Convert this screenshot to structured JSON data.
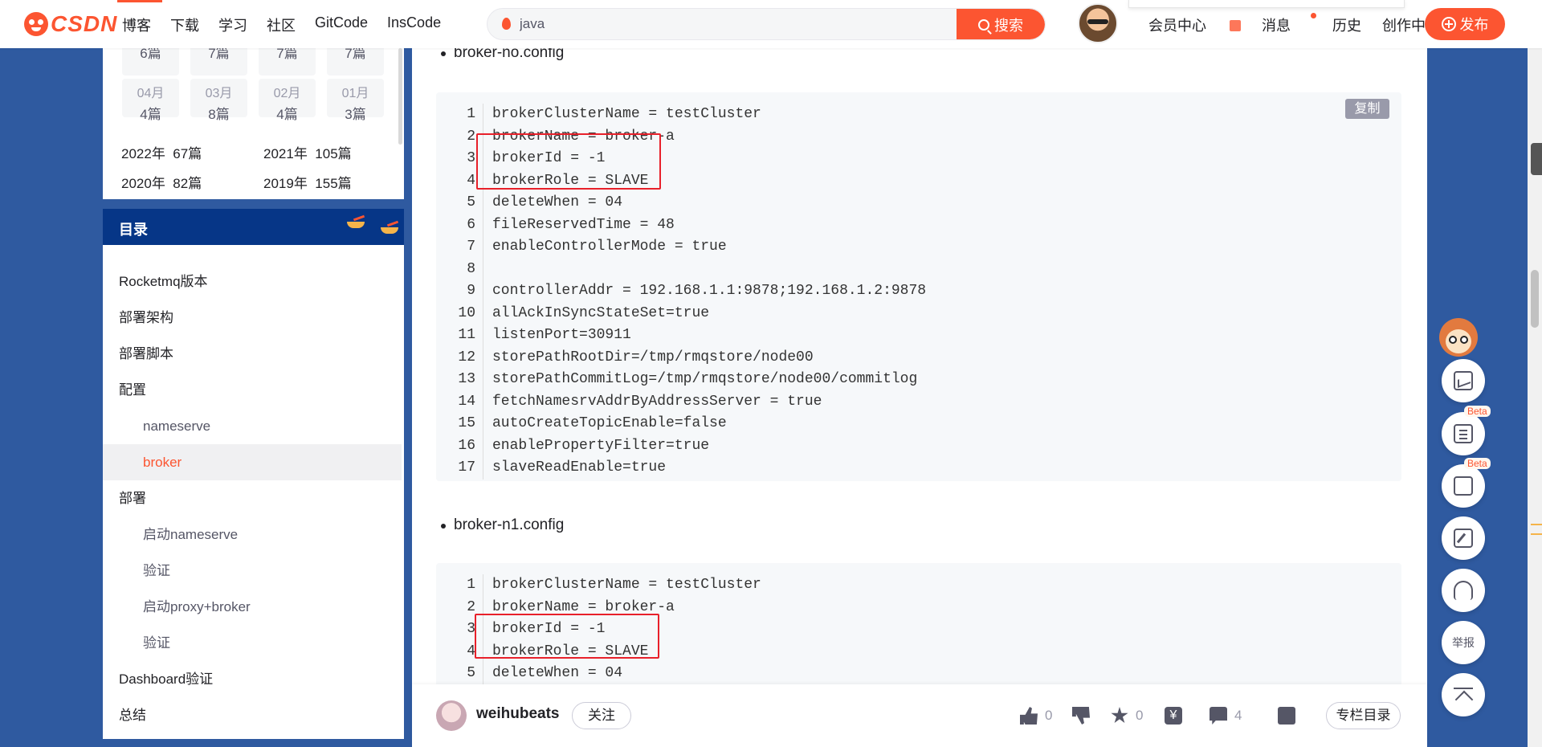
{
  "header": {
    "logo_text": "CSDN",
    "nav": [
      "博客",
      "下载",
      "学习",
      "社区",
      "GitCode",
      "InsCode"
    ],
    "search_value": "java",
    "search_button": "搜索",
    "right_nav": [
      "会员中心",
      "消息",
      "历史",
      "创作中心"
    ],
    "publish_label": "发布"
  },
  "archive": {
    "row1": [
      {
        "count": "6篇"
      },
      {
        "count": "7篇"
      },
      {
        "count": "7篇"
      },
      {
        "count": "7篇"
      }
    ],
    "row2": [
      {
        "month": "04月",
        "count": "4篇"
      },
      {
        "month": "03月",
        "count": "8篇"
      },
      {
        "month": "02月",
        "count": "4篇"
      },
      {
        "month": "01月",
        "count": "3篇"
      }
    ],
    "years": [
      {
        "year": "2022年",
        "count": "67篇"
      },
      {
        "year": "2021年",
        "count": "105篇"
      },
      {
        "year": "2020年",
        "count": "82篇"
      },
      {
        "year": "2019年",
        "count": "155篇"
      }
    ]
  },
  "toc": {
    "title": "目录",
    "items": [
      {
        "label": "Rocketmq版本",
        "level": 1
      },
      {
        "label": "部署架构",
        "level": 1
      },
      {
        "label": "部署脚本",
        "level": 1
      },
      {
        "label": "配置",
        "level": 1
      },
      {
        "label": "nameserve",
        "level": 2
      },
      {
        "label": "broker",
        "level": 2,
        "active": true
      },
      {
        "label": "部署",
        "level": 1
      },
      {
        "label": "启动nameserve",
        "level": 2
      },
      {
        "label": "验证",
        "level": 2
      },
      {
        "label": "启动proxy+broker",
        "level": 2
      },
      {
        "label": "验证",
        "level": 2
      },
      {
        "label": "Dashboard验证",
        "level": 1
      },
      {
        "label": "总结",
        "level": 1
      }
    ]
  },
  "article": {
    "bullet1": "broker-no.config",
    "bullet2": "broker-n1.config",
    "copy_label": "复制",
    "code1": {
      "line_numbers": [
        "1",
        "2",
        "3",
        "4",
        "5",
        "6",
        "7",
        "8",
        "9",
        "10",
        "11",
        "12",
        "13",
        "14",
        "15",
        "16",
        "17"
      ],
      "lines": [
        "brokerClusterName = testCluster",
        "brokerName = broker-a",
        "brokerId = -1",
        "brokerRole = SLAVE",
        "deleteWhen = 04",
        "fileReservedTime = 48",
        "enableControllerMode = true",
        "",
        "controllerAddr = 192.168.1.1:9878;192.168.1.2:9878",
        "allAckInSyncStateSet=true",
        "listenPort=30911",
        "storePathRootDir=/tmp/rmqstore/node00",
        "storePathCommitLog=/tmp/rmqstore/node00/commitlog",
        "fetchNamesrvAddrByAddressServer = true",
        "autoCreateTopicEnable=false",
        "enablePropertyFilter=true",
        "slaveReadEnable=true"
      ]
    },
    "code2": {
      "line_numbers": [
        "1",
        "2",
        "3",
        "4",
        "5"
      ],
      "lines": [
        "brokerClusterName = testCluster",
        "brokerName = broker-a",
        "brokerId = -1",
        "brokerRole = SLAVE",
        "deleteWhen = 04"
      ]
    }
  },
  "bottom": {
    "author": "weihubeats",
    "follow": "关注",
    "likes": "0",
    "favorites": "0",
    "comments": "4",
    "column_toc": "专栏目录"
  },
  "floating": {
    "beta": "Beta",
    "report": "举报"
  },
  "colors": {
    "brand": "#fc5531",
    "toc_header": "#063687",
    "highlight_box": "#e8202a"
  }
}
